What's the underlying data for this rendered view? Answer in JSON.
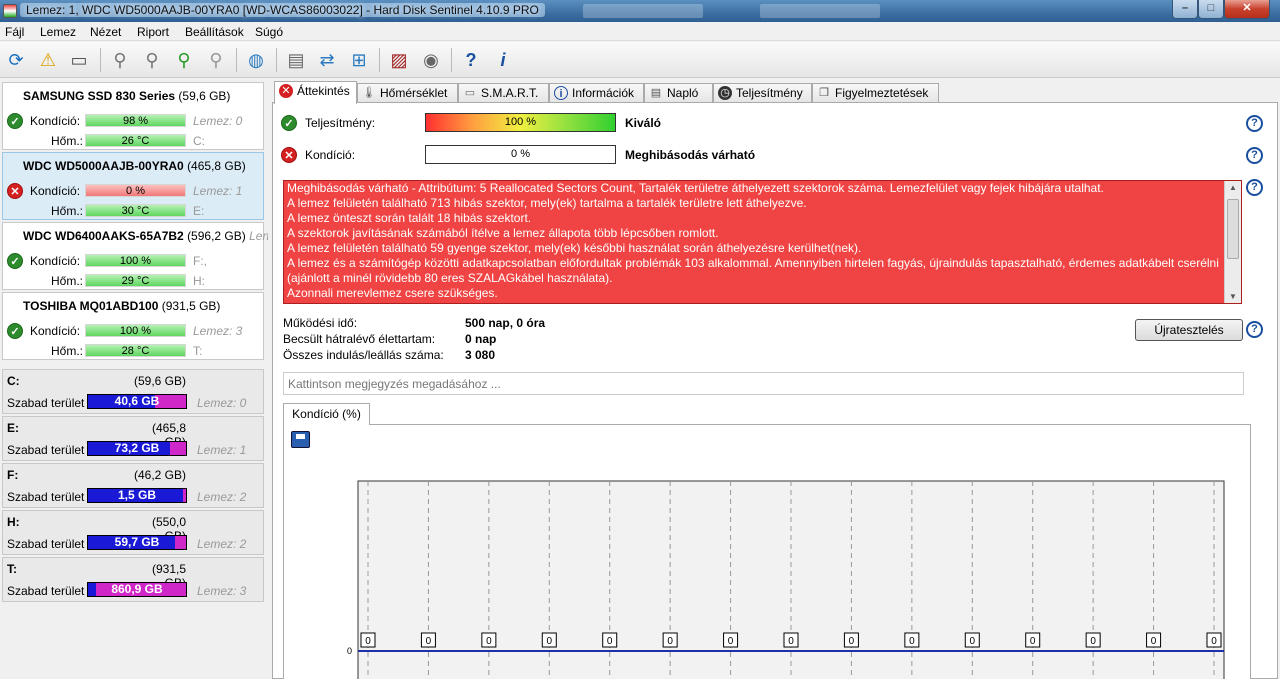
{
  "window": {
    "title": "Lemez: 1, WDC WD5000AAJB-00YRA0 [WD-WCAS86003022]  -  Hard Disk Sentinel 4.10.9 PRO",
    "minimize": "–",
    "maximize": "□",
    "close": "✕"
  },
  "menu": [
    "Fájl",
    "Lemez",
    "Nézet",
    "Riport",
    "Beállítások",
    "Súgó"
  ],
  "toolbar": {
    "icons": [
      "refresh-icon",
      "warning-icon",
      "disk-icon",
      "usb-disk-icon",
      "usb-disk-2-icon",
      "usb-disk-ok-icon",
      "usb-disk-gray-icon",
      "globe-icon",
      "document-icon",
      "sync-icon",
      "network-icon",
      "chart-monitor-icon",
      "speaker-icon",
      "help-icon",
      "info-icon"
    ]
  },
  "disks": [
    {
      "name": "SAMSUNG SSD 830 Series",
      "size": "(59,6 GB)",
      "status": "ok",
      "condition_label": "Kondíció:",
      "condition_value": "98 %",
      "condition_state": "green",
      "condition_extra": "Lemez: 0",
      "temp_label": "Hőm.:",
      "temp_value": "26 °C",
      "temp_extra": "C:"
    },
    {
      "name": "WDC WD5000AAJB-00YRA0",
      "size": "(465,8 GB)",
      "status": "bad",
      "condition_label": "Kondíció:",
      "condition_value": "0 %",
      "condition_state": "red",
      "condition_extra": "Lemez: 1",
      "temp_label": "Hőm.:",
      "temp_value": "30 °C",
      "temp_extra": "E:"
    },
    {
      "name": "WDC WD6400AAKS-65A7B2",
      "size": "(596,2 GB)",
      "size_extra": "Len",
      "status": "ok",
      "condition_label": "Kondíció:",
      "condition_value": "100 %",
      "condition_state": "green",
      "condition_extra": "F:,",
      "temp_label": "Hőm.:",
      "temp_value": "29 °C",
      "temp_extra": "H:"
    },
    {
      "name": "TOSHIBA MQ01ABD100",
      "size": "(931,5 GB)",
      "status": "ok",
      "condition_label": "Kondíció:",
      "condition_value": "100 %",
      "condition_state": "green",
      "condition_extra": "Lemez: 3",
      "temp_label": "Hőm.:",
      "temp_value": "28 °C",
      "temp_extra": "T:"
    }
  ],
  "volumes": [
    {
      "letter": "C:",
      "size": "(59,6 GB)",
      "free_label": "Szabad terület",
      "free": "40,6 GB",
      "used_fraction": 0.32,
      "disk": "Lemez: 0"
    },
    {
      "letter": "E:",
      "size": "(465,8 GB)",
      "free_label": "Szabad terület",
      "free": "73,2 GB",
      "used_fraction": 0.16,
      "disk": "Lemez: 1"
    },
    {
      "letter": "F:",
      "size": "(46,2 GB)",
      "free_label": "Szabad terület",
      "free": "1,5 GB",
      "used_fraction": 0.03,
      "disk": "Lemez: 2"
    },
    {
      "letter": "H:",
      "size": "(550,0 GB)",
      "free_label": "Szabad terület",
      "free": "59,7 GB",
      "used_fraction": 0.11,
      "disk": "Lemez: 2"
    },
    {
      "letter": "T:",
      "size": "(931,5 GB)",
      "free_label": "Szabad terület",
      "free": "860,9 GB",
      "used_fraction": 0.92,
      "disk": "Lemez: 3"
    }
  ],
  "tabs": [
    {
      "label": "Áttekintés",
      "icon": "error-icon"
    },
    {
      "label": "Hőmérséklet",
      "icon": "thermometer-icon"
    },
    {
      "label": "S.M.A.R.T.",
      "icon": "disk-icon"
    },
    {
      "label": "Információk",
      "icon": "info-icon"
    },
    {
      "label": "Napló",
      "icon": "log-icon"
    },
    {
      "label": "Teljesítmény",
      "icon": "gauge-icon"
    },
    {
      "label": "Figyelmeztetések",
      "icon": "alerts-icon"
    }
  ],
  "overview": {
    "performance": {
      "label": "Teljesítmény:",
      "value": "100 %",
      "percent": 100,
      "verdict": "Kiváló"
    },
    "condition": {
      "label": "Kondíció:",
      "value": "0 %",
      "percent": 0,
      "verdict": "Meghibásodás várható"
    },
    "alert_lines": [
      "Meghibásodás várható - Attribútum: 5 Reallocated Sectors Count, Tartalék területre áthelyezett szektorok száma. Lemezfelület vagy fejek hibájára utalhat.",
      "A lemez felületén található 713 hibás szektor, mely(ek) tartalma a tartalék területre lett áthelyezve.",
      "A lemez önteszt során talált 18 hibás szektort.",
      "A szektorok javításának számából ítélve a lemez állapota több lépcsőben romlott.",
      "A lemez felületén található 59 gyenge szektor, mely(ek) későbbi használat során áthelyezésre kerülhet(nek).",
      "A lemez és a számítógép közötti adatkapcsolatban előfordultak problémák 103 alkalommal. Amennyiben hirtelen fagyás, újraindulás tapasztalható, érdemes adatkábelt cserélni (ajánlott a minél rövidebb 80 eres SZALAGkábel használata).",
      "Azonnali merevlemez csere szükséges."
    ],
    "stats": [
      {
        "label": "Működési idő:",
        "value": "500 nap, 0 óra"
      },
      {
        "label": "Becsült hátralévő élettartam:",
        "value": "0 nap"
      },
      {
        "label": "Összes indulás/leállás száma:",
        "value": "3 080"
      }
    ],
    "retest_button": "Újratesztelés",
    "note_placeholder": "Kattintson megjegyzés megadásához ...",
    "chart_tab": "Kondíció  (%)"
  },
  "chart_data": {
    "type": "line",
    "title": "Kondíció  (%)",
    "xlabel": "",
    "ylabel": "",
    "series": [
      {
        "values": [
          0,
          0,
          0,
          0,
          0,
          0,
          0,
          0,
          0,
          0,
          0,
          0,
          0,
          0,
          0
        ]
      }
    ],
    "point_labels": [
      "0",
      "0",
      "0",
      "0",
      "0",
      "0",
      "0",
      "0",
      "0",
      "0",
      "0",
      "0",
      "0",
      "0",
      "0"
    ],
    "y_tick_labels": [
      "0"
    ],
    "ylim": [
      0,
      100
    ],
    "grid": true,
    "colors": {
      "line": "#1f2fa8"
    }
  },
  "colors": {
    "alert_bg": "#f04444",
    "ok_green": "#2d8a2d",
    "bad_red": "#d42020",
    "volume_free": "#1a1ad6",
    "volume_used": "#d028c8"
  }
}
